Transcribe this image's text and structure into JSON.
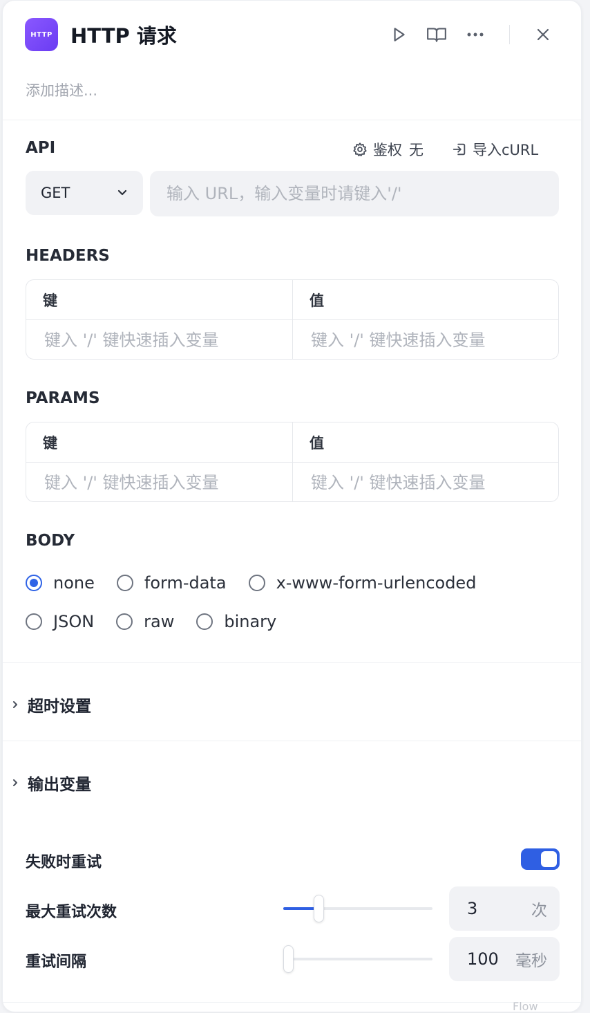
{
  "header": {
    "icon_label": "HTTP",
    "title": "HTTP 请求",
    "description_placeholder": "添加描述..."
  },
  "api": {
    "label": "API",
    "auth_label": "鉴权",
    "auth_value": "无",
    "import_label": "导入cURL",
    "method": "GET",
    "url_placeholder": "输入 URL，输入变量时请键入'/'"
  },
  "headers": {
    "label": "HEADERS",
    "key_header": "键",
    "value_header": "值",
    "key_placeholder": "键入 '/' 键快速插入变量",
    "value_placeholder": "键入 '/' 键快速插入变量"
  },
  "params": {
    "label": "PARAMS",
    "key_header": "键",
    "value_header": "值",
    "key_placeholder": "键入 '/' 键快速插入变量",
    "value_placeholder": "键入 '/' 键快速插入变量"
  },
  "body": {
    "label": "BODY",
    "selected": "none",
    "options": [
      "none",
      "form-data",
      "x-www-form-urlencoded",
      "JSON",
      "raw",
      "binary"
    ]
  },
  "sections": {
    "timeout": "超时设置",
    "output_vars": "输出变量"
  },
  "retry": {
    "label": "失败时重试",
    "enabled": true,
    "max_retries_label": "最大重试次数",
    "max_retries_value": "3",
    "max_retries_unit": "次",
    "max_retries_fraction": 0.24,
    "interval_label": "重试间隔",
    "interval_value": "100",
    "interval_unit": "毫秒",
    "interval_fraction": 0.0
  },
  "colors": {
    "accent": "#2f5fe3",
    "icon_bg": "#7b4dfb"
  },
  "background_text": "Flow"
}
